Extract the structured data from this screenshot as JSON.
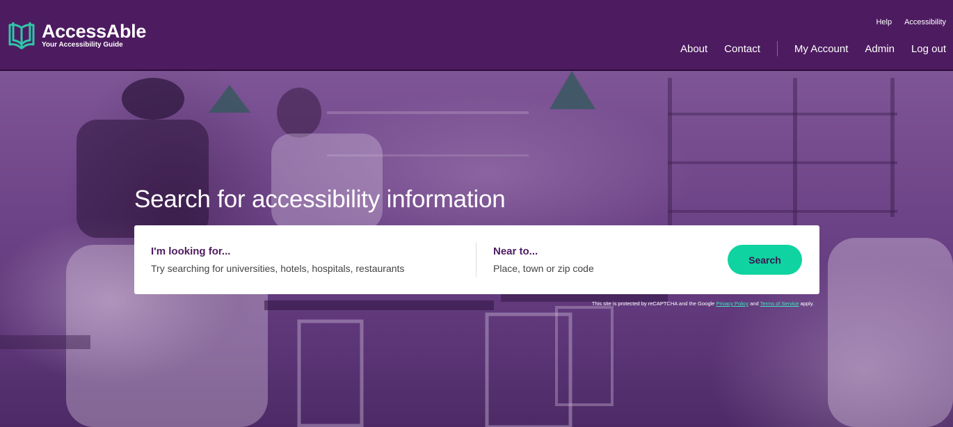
{
  "brand": {
    "name": "AccessAble",
    "tagline": "Your Accessibility Guide",
    "accent_color": "#0fd3a0",
    "primary_color": "#4d1b60"
  },
  "util_nav": {
    "help": "Help",
    "accessibility": "Accessibility"
  },
  "main_nav": {
    "about": "About",
    "contact": "Contact",
    "my_account": "My Account",
    "admin": "Admin",
    "logout": "Log out"
  },
  "hero": {
    "title": "Search for accessibility information"
  },
  "search": {
    "what_label": "I'm looking for...",
    "what_placeholder": "Try searching for universities, hotels, hospitals, restaurants",
    "where_label": "Near to...",
    "where_placeholder": "Place, town or zip code",
    "button_label": "Search"
  },
  "recaptcha": {
    "prefix": "This site is protected by reCAPTCHA and the Google",
    "privacy": "Privacy Policy",
    "and": "and",
    "terms": "Terms of Service",
    "suffix": "apply."
  }
}
